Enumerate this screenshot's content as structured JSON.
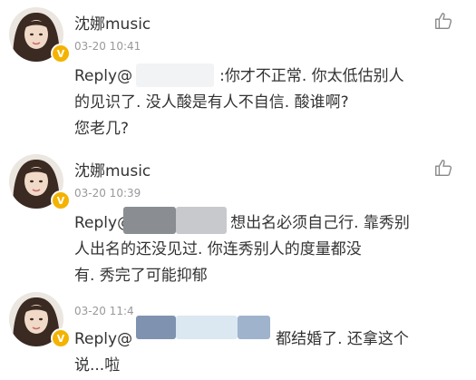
{
  "comments": [
    {
      "username": "沈娜music",
      "time": "03-20 10:41",
      "reply_prefix": "Reply@",
      "line1": ":你才不正常. 你太低估别人",
      "line2": "的见识了. 没人酸是有人不自信. 酸谁啊?",
      "line3": "您老几?"
    },
    {
      "username": "沈娜music",
      "time": "03-20 10:39",
      "reply_prefix": "Reply@",
      "line1": "想出名必须自己行. 靠秀别",
      "line2": "人出名的还没见过. 你连秀别人的度量都没",
      "line3": "有. 秀完了可能抑郁"
    },
    {
      "username": "沈娜music",
      "time": "03-20 11:4",
      "reply_prefix": "Reply@",
      "line1": "都结婚了. 还拿这个",
      "line2": "说...啦"
    }
  ],
  "icons": {
    "like": "thumbs-up-icon",
    "badge": "verified-v-icon"
  },
  "colors": {
    "badge": "#f3b300",
    "time": "#999999",
    "text": "#333333"
  }
}
